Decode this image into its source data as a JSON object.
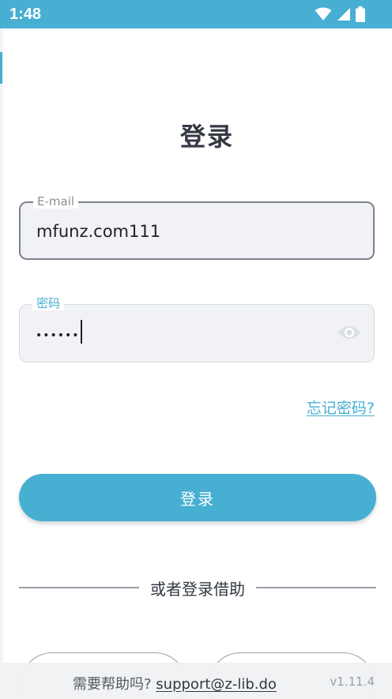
{
  "status_bar": {
    "time": "1:48",
    "icons": [
      "wifi-icon",
      "signal-icon",
      "battery-icon"
    ],
    "color": "#47afd2"
  },
  "login": {
    "title": "登录",
    "email": {
      "label": "E-mail",
      "value": "mfunz.com111"
    },
    "password": {
      "label": "密码",
      "masked_value": "••••••"
    },
    "forgot_link": "忘记密码?",
    "submit_label": "登录",
    "divider_text": "或者登录借助"
  },
  "footer": {
    "help_prefix": "需要帮助吗?",
    "support_email": "support@z-lib.do",
    "version": "v1.11.4"
  },
  "colors": {
    "accent": "#47afd2",
    "text": "#333842",
    "field_bg": "#f1f2f5"
  }
}
